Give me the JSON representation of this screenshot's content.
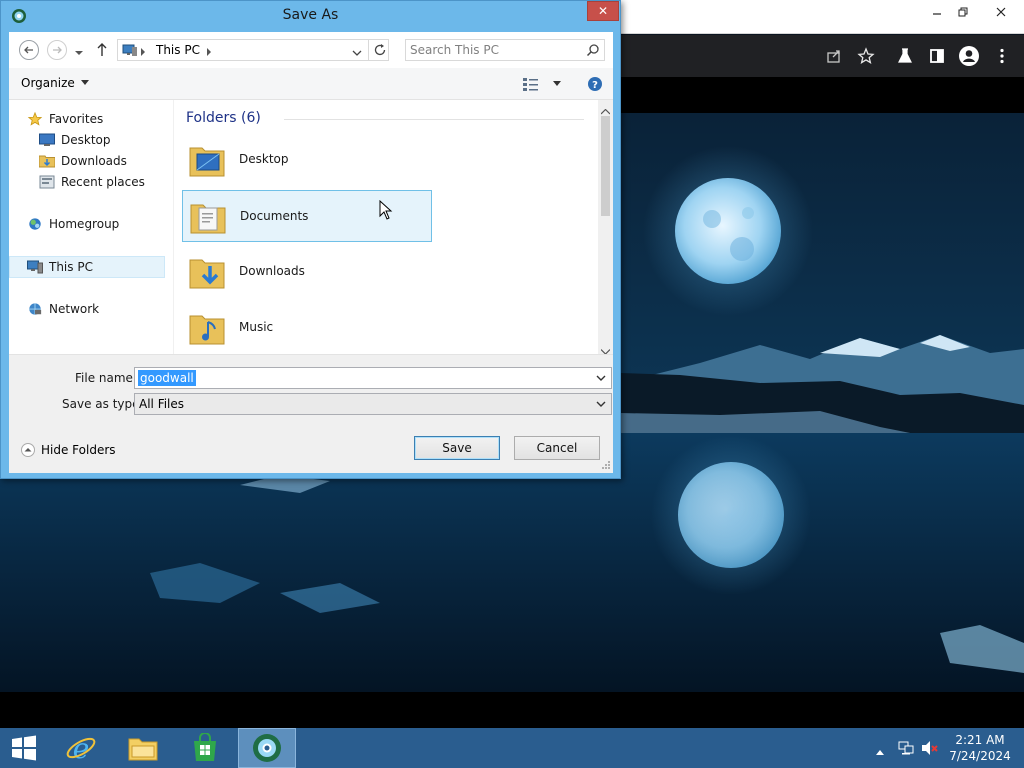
{
  "dialog": {
    "title": "Save As",
    "close_label": "✕",
    "back_icon": "back-arrow-icon",
    "forward_icon": "forward-arrow-icon",
    "address": {
      "location": "This PC"
    },
    "search": {
      "placeholder": "Search This PC"
    },
    "command_bar": {
      "organize_label": "Organize"
    },
    "nav": {
      "favorites": {
        "label": "Favorites",
        "items": [
          "Desktop",
          "Downloads",
          "Recent places"
        ]
      },
      "homegroup": "Homegroup",
      "this_pc": "This PC",
      "network": "Network"
    },
    "files": {
      "group_header": "Folders (6)",
      "folders": [
        "Desktop",
        "Documents",
        "Downloads",
        "Music"
      ]
    },
    "file_name": {
      "label": "File name:",
      "value": "goodwall"
    },
    "save_type": {
      "label": "Save as type:",
      "value": "All Files"
    },
    "hide_folders_label": "Hide Folders",
    "save_label": "Save",
    "cancel_label": "Cancel"
  },
  "taskbar": {
    "time": "2:21 AM",
    "date": "7/24/2024"
  },
  "colors": {
    "dialog_frame": "#6cb8ea",
    "close_button": "#c7504a",
    "taskbar": "#2a5d8f",
    "selection": "#e5f3fb",
    "filename_highlight": "#3399ff"
  }
}
